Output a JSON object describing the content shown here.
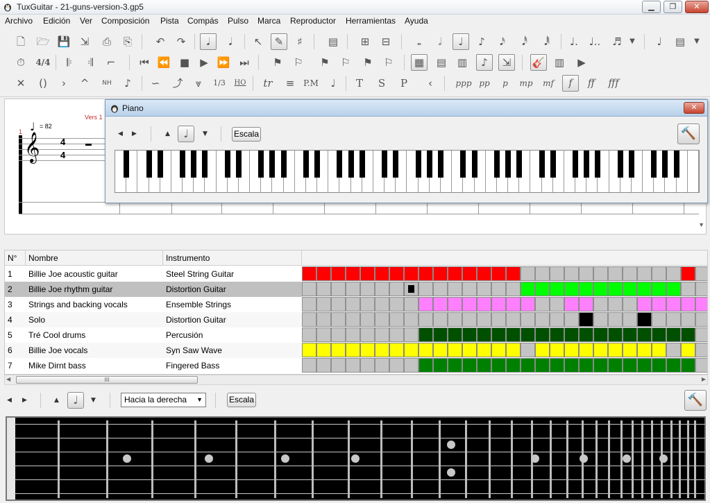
{
  "window": {
    "title": "TuxGuitar - 21-guns-version-3.gp5"
  },
  "menu": [
    "Archivo",
    "Edición",
    "Ver",
    "Composición",
    "Pista",
    "Compás",
    "Pulso",
    "Marca",
    "Reproductor",
    "Herramientas",
    "Ayuda"
  ],
  "score": {
    "tempo": "= 82",
    "measure_number": "1",
    "marker": "Vers 1",
    "time_sig_top": "4",
    "time_sig_bottom": "4"
  },
  "dynamics": [
    "ppp",
    "pp",
    "p",
    "mp",
    "mf",
    "f",
    "ff",
    "fff"
  ],
  "effects_text": [
    "tr",
    "P.M",
    "T",
    "S",
    "P",
    "1/3",
    "HO"
  ],
  "piano": {
    "title": "Piano",
    "scale_button": "Escala",
    "white_keys": 52
  },
  "tracks": {
    "headers": [
      "N°",
      "Nombre",
      "Instrumento"
    ],
    "rows": [
      {
        "num": "1",
        "name": "Billie Joe acoustic guitar",
        "instrument": "Steel String Guitar",
        "color": "#ff0000",
        "pattern": "FFFFFFFFFFFFFFFEEEEEEEEEEEF"
      },
      {
        "num": "2",
        "name": "Billie Joe rhythm guitar",
        "instrument": "Distortion Guitar",
        "color": "#00ff00",
        "pattern": "EEEEEEEXEEEEEEEFFFFFFFFFFFE",
        "selected": true
      },
      {
        "num": "3",
        "name": "Strings and backing vocals",
        "instrument": "Ensemble Strings",
        "color": "#ff80ff",
        "pattern": "EEEEEEEEFFFFFFFFEEFFEEEFFFFF"
      },
      {
        "num": "4",
        "name": "Solo",
        "instrument": "Distortion Guitar",
        "color": "#000000",
        "pattern": "EEEEEEEEEEEEEEEEEEEXEEEXEEE"
      },
      {
        "num": "5",
        "name": "Tré Cool drums",
        "instrument": "Percusión",
        "color": "#005000",
        "pattern": "EEEEEEEEFFFFFFFFFFFFFFFFFFF"
      },
      {
        "num": "6",
        "name": "Billie Joe vocals",
        "instrument": "Syn Saw Wave",
        "color": "#ffff00",
        "pattern": "FFFFFFFFFFFFFFFEFFFFFFFFFEF"
      },
      {
        "num": "7",
        "name": "Mike Dirnt bass",
        "instrument": "Fingered Bass",
        "color": "#008000",
        "pattern": "EEEEEEEEFFFFFFFFFFFFFFFFFFF"
      }
    ]
  },
  "fretboard": {
    "direction_select": "Hacia la derecha",
    "scale_button": "Escala"
  },
  "scroll_thumb": "III"
}
